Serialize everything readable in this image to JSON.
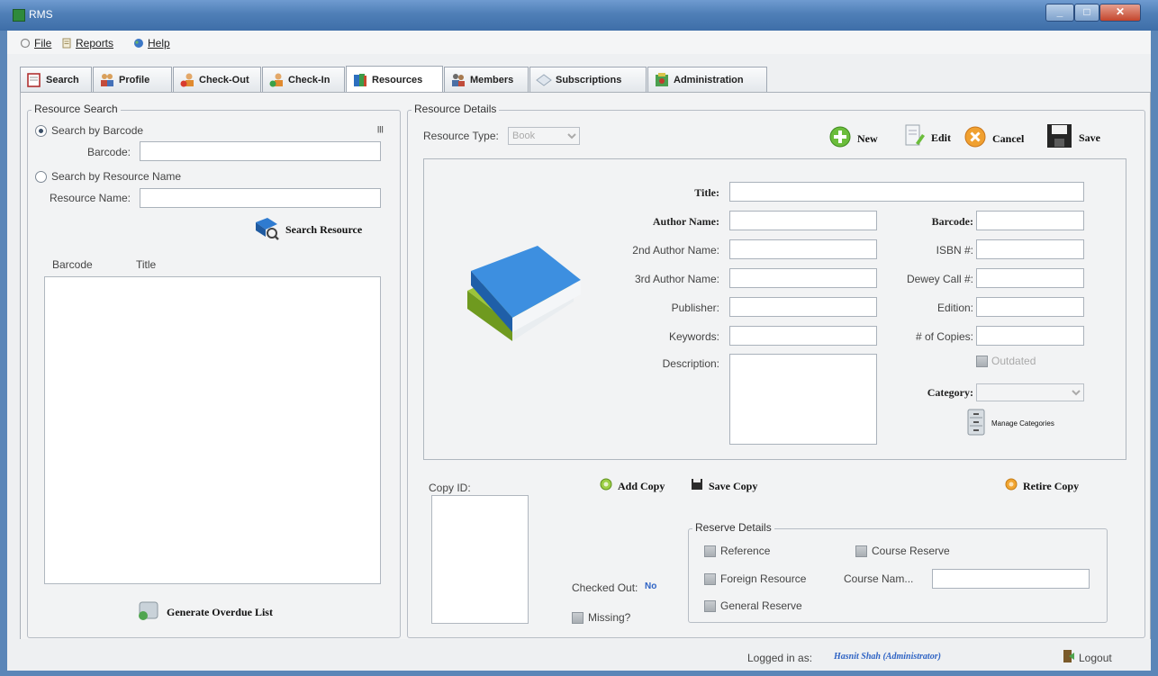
{
  "window": {
    "title": "RMS"
  },
  "menu": [
    {
      "label": "File",
      "icon": "file-icon"
    },
    {
      "label": "Reports",
      "icon": "reports-icon"
    },
    {
      "label": "Help",
      "icon": "help-icon"
    }
  ],
  "tabs": [
    {
      "label": "Search",
      "icon": "search-icon"
    },
    {
      "label": "Profile",
      "icon": "profile-icon"
    },
    {
      "label": "Check-Out",
      "icon": "check-out-icon"
    },
    {
      "label": "Check-In",
      "icon": "check-in-icon"
    },
    {
      "label": "Resources",
      "icon": "resources-icon",
      "active": true
    },
    {
      "label": "Members",
      "icon": "members-icon"
    },
    {
      "label": "Subscriptions",
      "icon": "subscriptions-icon"
    },
    {
      "label": "Administration",
      "icon": "administration-icon"
    }
  ],
  "resource_search": {
    "legend": "Resource Search",
    "by_barcode": "Search by Barcode",
    "barcode_label": "Barcode:",
    "barcode_value": "",
    "by_name": "Search by Resource Name",
    "name_label": "Resource Name:",
    "name_value": "",
    "search_button": "Search Resource",
    "columns": [
      "Barcode",
      "Title"
    ],
    "generate_overdue": "Generate Overdue List"
  },
  "resource_details": {
    "legend": "Resource Details",
    "type_label": "Resource Type:",
    "type_value": "Book",
    "toolbar": {
      "new": "New",
      "edit": "Edit",
      "cancel": "Cancel",
      "save": "Save"
    },
    "labels": {
      "title": "Title:",
      "author": "Author Name:",
      "author2": "2nd Author Name:",
      "author3": "3rd Author Name:",
      "publisher": "Publisher:",
      "keywords": "Keywords:",
      "description": "Description:",
      "barcode": "Barcode:",
      "isbn": "ISBN #:",
      "dewey": "Dewey Call #:",
      "edition": "Edition:",
      "copies": "# of Copies:",
      "outdated": "Outdated",
      "category": "Category:",
      "manage_categories": "Manage Categories"
    }
  },
  "copy": {
    "copy_id_label": "Copy ID:",
    "add_copy": "Add Copy",
    "save_copy": "Save Copy",
    "retire_copy": "Retire Copy",
    "checked_out_label": "Checked Out:",
    "checked_out_value": "No",
    "missing": "Missing?"
  },
  "reserve": {
    "legend": "Reserve Details",
    "reference": "Reference",
    "course_reserve": "Course Reserve",
    "foreign_resource": "Foreign Resource",
    "course_name_label": "Course Nam...",
    "general_reserve": "General Reserve"
  },
  "status": {
    "logged_in_label": "Logged in as:",
    "user": "Hasnit Shah (Administrator)",
    "logout": "Logout"
  }
}
